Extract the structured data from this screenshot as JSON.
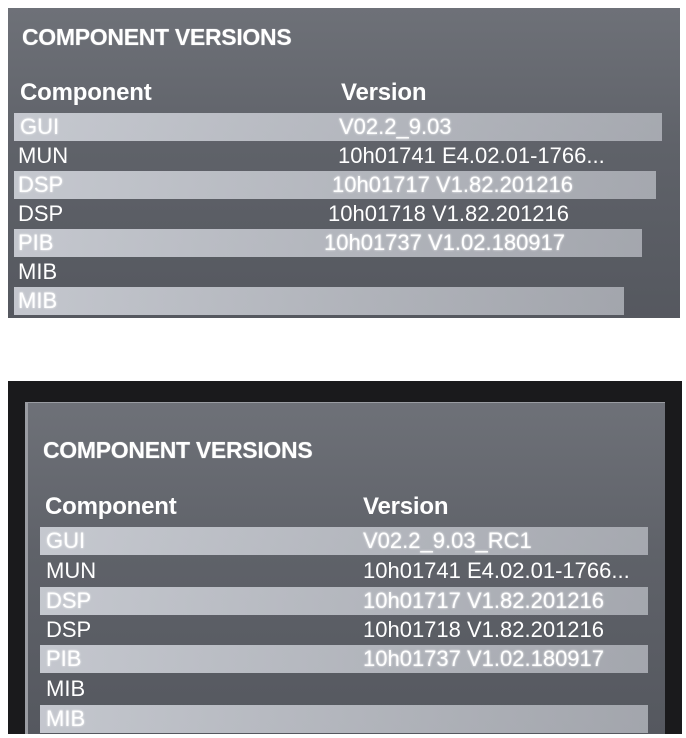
{
  "photos": [
    {
      "title": "COMPONENT VERSIONS",
      "columns": {
        "component": "Component",
        "version": "Version"
      },
      "rows": [
        {
          "component": "GUI",
          "version": "V02.2_9.03"
        },
        {
          "component": "MUN",
          "version": "10h01741 E4.02.01-1766..."
        },
        {
          "component": "DSP",
          "version": "10h01717 V1.82.201216"
        },
        {
          "component": "DSP",
          "version": "10h01718 V1.82.201216"
        },
        {
          "component": "PIB",
          "version": "10h01737 V1.02.180917"
        },
        {
          "component": "MIB",
          "version": ""
        },
        {
          "component": "MIB",
          "version": ""
        }
      ]
    },
    {
      "title": "COMPONENT VERSIONS",
      "columns": {
        "component": "Component",
        "version": "Version"
      },
      "rows": [
        {
          "component": "GUI",
          "version": "V02.2_9.03_RC1"
        },
        {
          "component": "MUN",
          "version": "10h01741 E4.02.01-1766..."
        },
        {
          "component": "DSP",
          "version": "10h01717 V1.82.201216"
        },
        {
          "component": "DSP",
          "version": "10h01718 V1.82.201216"
        },
        {
          "component": "PIB",
          "version": "10h01737 V1.02.180917"
        },
        {
          "component": "MIB",
          "version": ""
        },
        {
          "component": "MIB",
          "version": ""
        }
      ]
    }
  ]
}
